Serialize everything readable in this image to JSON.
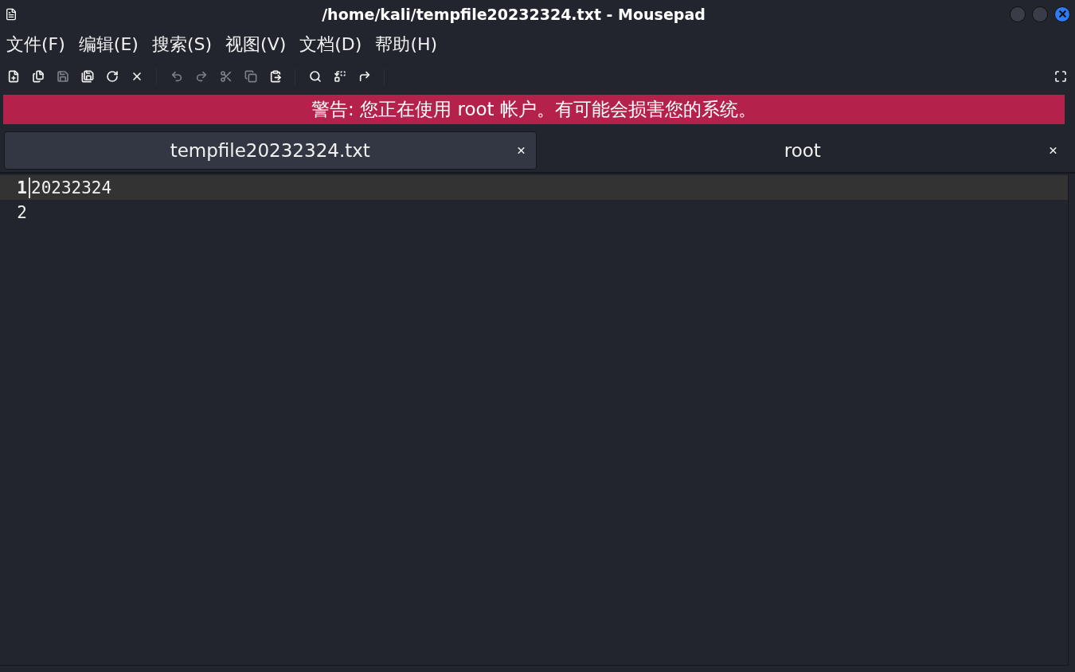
{
  "window": {
    "title": "/home/kali/tempfile20232324.txt - Mousepad"
  },
  "menu": [
    "文件(F)",
    "编辑(E)",
    "搜索(S)",
    "视图(V)",
    "文档(D)",
    "帮助(H)"
  ],
  "toolbar": [
    [
      {
        "kind": "new",
        "disabled": false
      },
      {
        "kind": "open",
        "disabled": false
      },
      {
        "kind": "save",
        "disabled": true
      },
      {
        "kind": "saveas",
        "disabled": false
      },
      {
        "kind": "reload",
        "disabled": false
      },
      {
        "kind": "close",
        "disabled": false
      }
    ],
    [
      {
        "kind": "undo",
        "disabled": true
      },
      {
        "kind": "redo",
        "disabled": true
      },
      {
        "kind": "cut",
        "disabled": true
      },
      {
        "kind": "copy",
        "disabled": true
      },
      {
        "kind": "paste",
        "disabled": false
      }
    ],
    [
      {
        "kind": "search",
        "disabled": false
      },
      {
        "kind": "replace",
        "disabled": false
      },
      {
        "kind": "goto",
        "disabled": false
      }
    ]
  ],
  "warning": "警告: 您正在使用 root 帐户。有可能会损害您的系统。",
  "tabs": [
    {
      "label": "tempfile20232324.txt",
      "selected": true
    },
    {
      "label": "root",
      "selected": false
    }
  ],
  "editor": {
    "lines": [
      {
        "number": "1",
        "text": "20232324",
        "current": true
      },
      {
        "number": "2",
        "current": false
      }
    ]
  }
}
